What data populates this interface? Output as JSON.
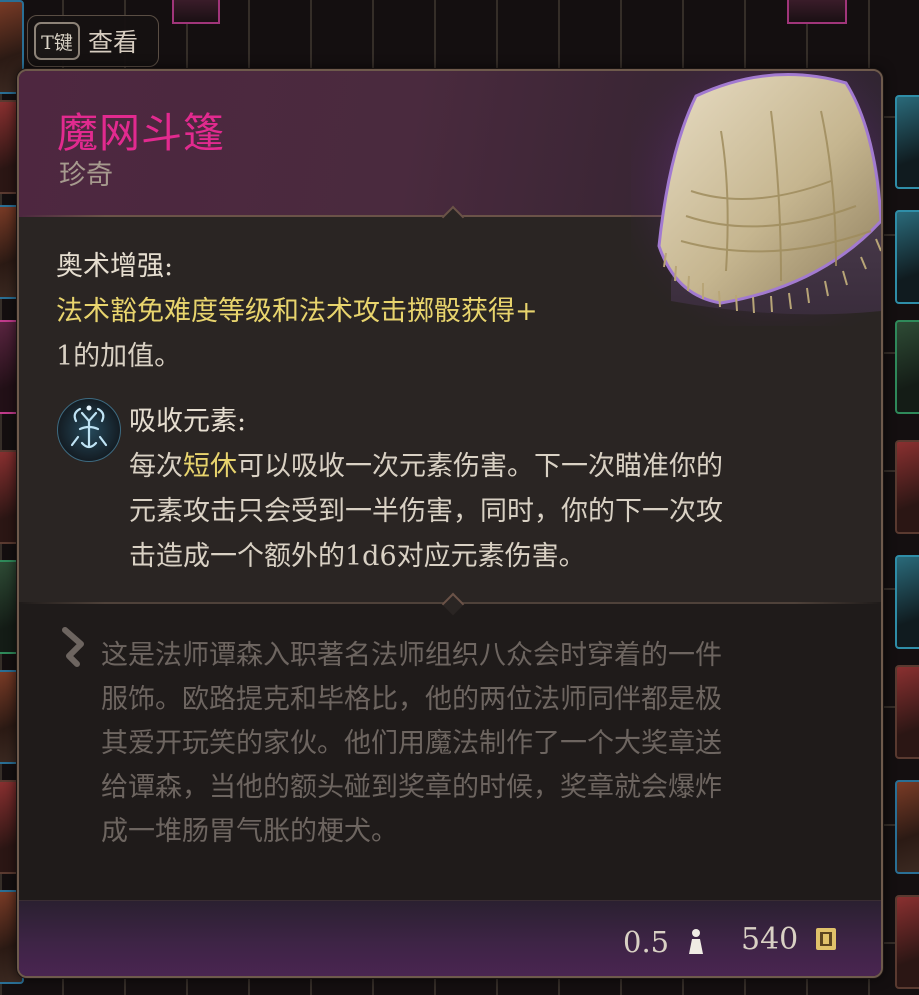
{
  "hint": {
    "key": "T键",
    "label": "查看"
  },
  "item": {
    "name": "魔网斗篷",
    "rarity": "珍奇",
    "icon": "cloak-image"
  },
  "enchantment": {
    "title": "奥术增强:",
    "line1": "法术豁免难度等级和法术攻击掷骰获得+",
    "line2": "1的加值。"
  },
  "passive": {
    "icon": "absorb-elements-icon",
    "title": "吸收元素:",
    "line1_pre": "每次",
    "line1_key": "短休",
    "line1_post": "可以吸收一次元素伤害。下一次瞄准你的",
    "line2": "元素攻击只会受到一半伤害，同时，你的下一次攻",
    "line3": "击造成一个额外的1d6对应元素伤害。"
  },
  "lore": {
    "lines": [
      "这是法师谭森入职著名法师组织八众会时穿着的一件",
      "服饰。欧路提克和毕格比，他的两位法师同伴都是极",
      "其爱开玩笑的家伙。他们用魔法制作了一个大奖章送",
      "给谭森，当他的额头碰到奖章的时候，奖章就会爆炸",
      "成一堆肠胃气胀的梗犬。"
    ]
  },
  "footer": {
    "weight": "0.5",
    "price": "540",
    "weight_icon": "weight-icon",
    "price_icon": "gold-icon"
  },
  "colors": {
    "title": "#e22a8f",
    "keyword": "#e8d46d",
    "text": "#d9d1c4",
    "lore": "#6d6560"
  }
}
